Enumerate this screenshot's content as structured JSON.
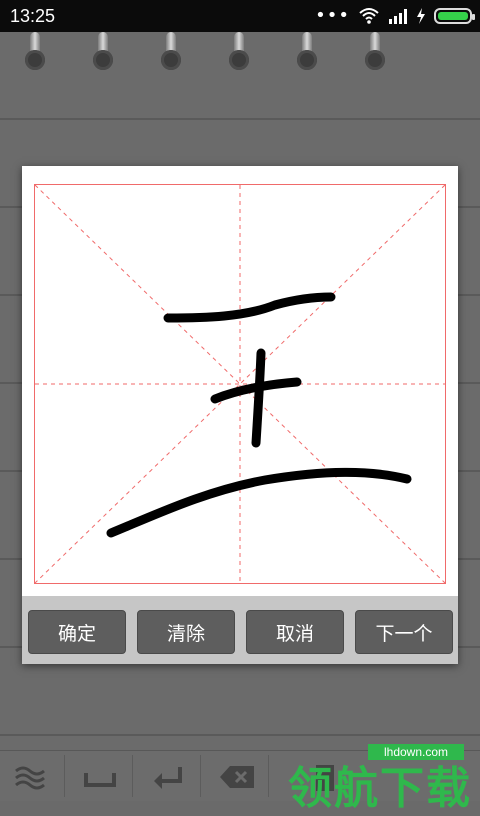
{
  "status_bar": {
    "time": "13:25",
    "dots": "•••",
    "icons": [
      "wifi-icon",
      "signal-icon",
      "charging-icon",
      "battery-icon"
    ],
    "battery_level": 1.0,
    "battery_color": "#35d04a"
  },
  "dialog": {
    "buttons": [
      {
        "label": "确定"
      },
      {
        "label": "清除"
      },
      {
        "label": "取消"
      },
      {
        "label": "下一个"
      }
    ],
    "guide_color": "#f06a6a"
  },
  "toolbar": {
    "icons": [
      "waves-icon",
      "space-icon",
      "enter-icon",
      "backspace-icon",
      "page-icon"
    ]
  },
  "watermark": {
    "text": "领航下载",
    "url": "lhdown.com",
    "color": "#2fb84c"
  }
}
